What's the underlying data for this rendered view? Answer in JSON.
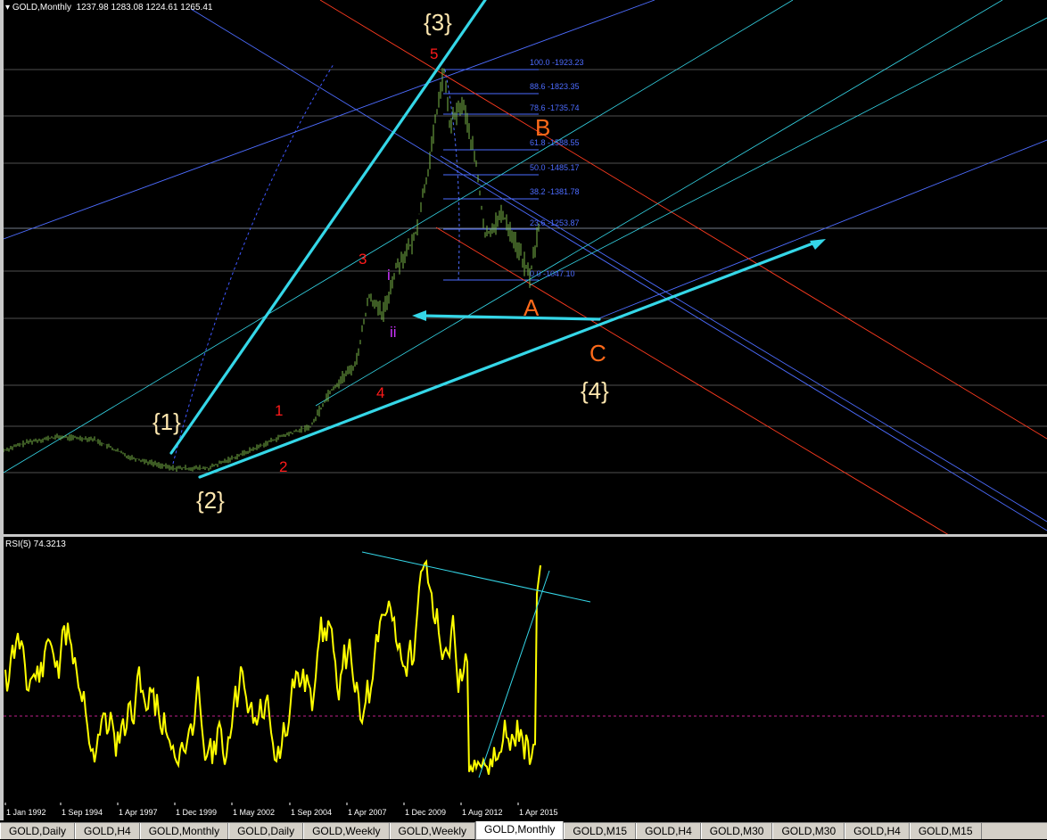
{
  "window": {
    "symbol_title": "GOLD,Monthly",
    "ohlc": "1237.98 1283.08 1224.61 1265.41"
  },
  "rsi": {
    "label": "RSI(5) 74.3213"
  },
  "fib_levels": [
    {
      "label": "100.0 -1923.23"
    },
    {
      "label": "88.6 -1823.35"
    },
    {
      "label": "78.6 -1735.74"
    },
    {
      "label": "61.8 -1588.55"
    },
    {
      "label": "50.0 -1485.17"
    },
    {
      "label": "38.2 -1381.78"
    },
    {
      "label": "23.6 -1253.87"
    },
    {
      "label": "0.0 -1047.10"
    }
  ],
  "wave_labels": {
    "w1": "{1}",
    "w2": "{2}",
    "w3": "{3}",
    "w4": "{4}",
    "m1": "1",
    "m2": "2",
    "m3": "3",
    "m4": "4",
    "m5": "5",
    "i": "i",
    "ii": "ii",
    "A": "A",
    "B": "B",
    "C": "C"
  },
  "x_axis": {
    "ticks": [
      "1 Jan 1992",
      "1 Sep 1994",
      "1 Apr 1997",
      "1 Dec 1999",
      "1 May 2002",
      "1 Sep 2004",
      "1 Apr 2007",
      "1 Dec 2009",
      "1 Aug 2012",
      "1 Apr 2015"
    ]
  },
  "tabs": [
    {
      "label": "GOLD,Daily",
      "active": false
    },
    {
      "label": "GOLD,H4",
      "active": false
    },
    {
      "label": "GOLD,Monthly",
      "active": false
    },
    {
      "label": "GOLD,Daily",
      "active": false
    },
    {
      "label": "GOLD,Weekly",
      "active": false
    },
    {
      "label": "GOLD,Weekly",
      "active": false
    },
    {
      "label": "GOLD,Monthly",
      "active": true
    },
    {
      "label": "GOLD,M15",
      "active": false
    },
    {
      "label": "GOLD,H4",
      "active": false
    },
    {
      "label": "GOLD,M30",
      "active": false
    },
    {
      "label": "GOLD,M30",
      "active": false
    },
    {
      "label": "GOLD,H4",
      "active": false
    },
    {
      "label": "GOLD,M15",
      "active": false
    }
  ],
  "colors": {
    "candles": "#7ab648",
    "rsi_line": "#ffff00",
    "trend_cyan": "#35d7e8",
    "fib_blue": "#4d6cff",
    "channel_red": "#ff3b1f",
    "wave_red": "#ff1a1a",
    "wave_orange": "#ff6a1a",
    "wave_cream": "#ffe8b0",
    "wave_magenta": "#cc33ff"
  }
}
